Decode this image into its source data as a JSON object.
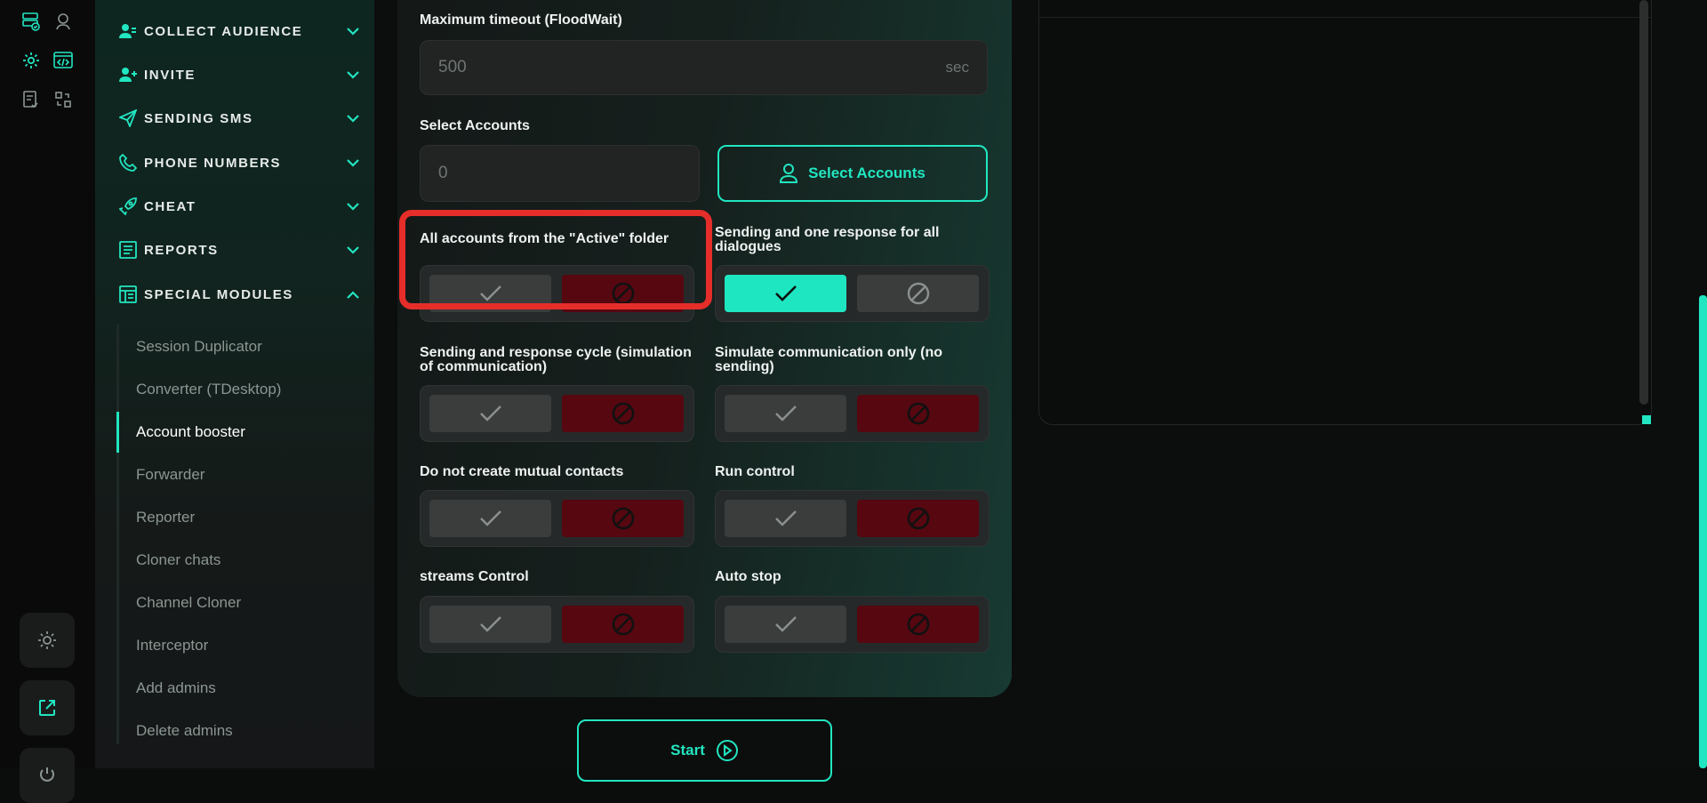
{
  "sidebar": {
    "nav": [
      {
        "label": "COLLECT AUDIENCE",
        "icon": "users-icon",
        "expanded": false
      },
      {
        "label": "INVITE",
        "icon": "user-plus-icon",
        "expanded": false
      },
      {
        "label": "SENDING SMS",
        "icon": "paper-plane-icon",
        "expanded": false
      },
      {
        "label": "PHONE NUMBERS",
        "icon": "phone-icon",
        "expanded": false
      },
      {
        "label": "CHEAT",
        "icon": "rocket-icon",
        "expanded": false
      },
      {
        "label": "REPORTS",
        "icon": "report-icon",
        "expanded": false
      },
      {
        "label": "SPECIAL MODULES",
        "icon": "modules-icon",
        "expanded": true
      }
    ],
    "sub_items": [
      "Session Duplicator",
      "Converter (TDesktop)",
      "Account booster",
      "Forwarder",
      "Reporter",
      "Cloner chats",
      "Channel Cloner",
      "Interceptor",
      "Add admins",
      "Delete admins"
    ],
    "active_sub_item": "Account booster"
  },
  "form": {
    "timeout_label": "Maximum timeout (FloodWait)",
    "timeout_value": "500",
    "timeout_unit": "sec",
    "accounts_label": "Select Accounts",
    "accounts_value": "0",
    "select_accounts_button": "Select Accounts",
    "toggles": [
      {
        "label": "All accounts from the \"Active\" folder",
        "state": "off",
        "highlighted": true
      },
      {
        "label": "Sending and one response for all dialogues",
        "state": "on"
      },
      {
        "label": "Sending and response cycle (simulation of communication)",
        "state": "off"
      },
      {
        "label": "Simulate communication only (no sending)",
        "state": "off"
      },
      {
        "label": "Do not create mutual contacts",
        "state": "off"
      },
      {
        "label": "Run control",
        "state": "off"
      },
      {
        "label": "streams Control",
        "state": "off"
      },
      {
        "label": "Auto stop",
        "state": "off"
      }
    ],
    "start_button": "Start"
  },
  "colors": {
    "accent": "#21e6c1",
    "off": "#560710",
    "highlight": "#e52e2a"
  }
}
